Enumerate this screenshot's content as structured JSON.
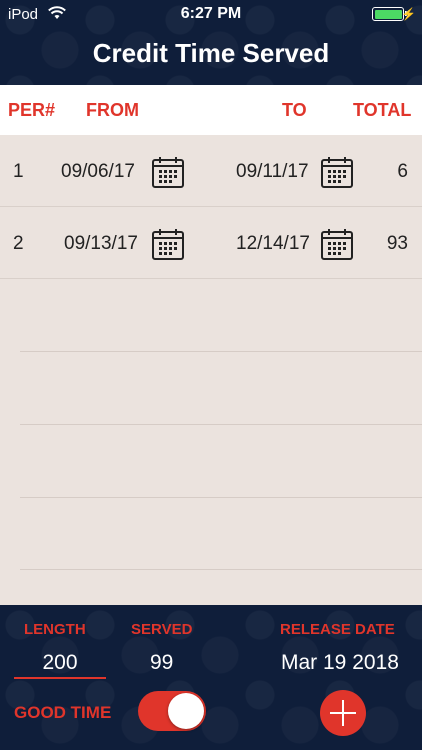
{
  "status_bar": {
    "carrier": "iPod",
    "time": "6:27 PM",
    "battery_color": "#4cd964"
  },
  "title": "Credit Time Served",
  "table_header": {
    "per": "PER#",
    "from": "FROM",
    "to": "TO",
    "total": "TOTAL"
  },
  "rows": [
    {
      "per": "1",
      "from": "09/06/17",
      "to": "09/11/17",
      "total": "6"
    },
    {
      "per": "2",
      "from": "09/13/17",
      "to": "12/14/17",
      "total": "93"
    }
  ],
  "summary": {
    "length_label": "LENGTH",
    "length_value": "200",
    "served_label": "SERVED",
    "served_value": "99",
    "release_label": "RELEASE DATE",
    "release_value": "Mar 19 2018",
    "good_time_label": "GOOD TIME",
    "good_time_on": true
  },
  "colors": {
    "accent": "#e0352b",
    "navy": "#0f1e3a",
    "table_bg": "#ebe3de"
  }
}
